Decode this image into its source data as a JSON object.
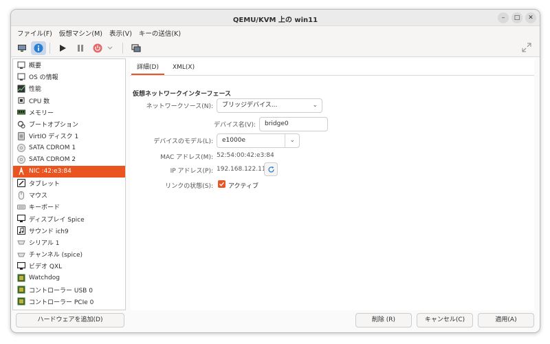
{
  "window": {
    "title": "QEMU/KVM 上の win11"
  },
  "menubar": [
    "ファイル(F)",
    "仮想マシン(M)",
    "表示(V)",
    "キーの送信(K)"
  ],
  "sidebar": {
    "items": [
      {
        "label": "概要",
        "icon": "overview-icon"
      },
      {
        "label": "OS の情報",
        "icon": "os-info-icon"
      },
      {
        "label": "性能",
        "icon": "performance-icon"
      },
      {
        "label": "CPU 数",
        "icon": "cpu-icon"
      },
      {
        "label": "メモリー",
        "icon": "memory-icon"
      },
      {
        "label": "ブートオプション",
        "icon": "boot-options-icon"
      },
      {
        "label": "VirtIO ディスク 1",
        "icon": "disk-icon"
      },
      {
        "label": "SATA CDROM 1",
        "icon": "cdrom-icon"
      },
      {
        "label": "SATA CDROM 2",
        "icon": "cdrom-icon"
      },
      {
        "label": "NIC :42:e3:84",
        "icon": "nic-icon",
        "selected": true
      },
      {
        "label": "タブレット",
        "icon": "tablet-icon"
      },
      {
        "label": "マウス",
        "icon": "mouse-icon"
      },
      {
        "label": "キーボード",
        "icon": "keyboard-icon"
      },
      {
        "label": "ディスプレイ Spice",
        "icon": "display-icon"
      },
      {
        "label": "サウンド ich9",
        "icon": "sound-icon"
      },
      {
        "label": "シリアル 1",
        "icon": "serial-icon"
      },
      {
        "label": "チャンネル (spice)",
        "icon": "channel-icon"
      },
      {
        "label": "ビデオ QXL",
        "icon": "video-icon"
      },
      {
        "label": "Watchdog",
        "icon": "watchdog-icon"
      },
      {
        "label": "コントローラー USB 0",
        "icon": "controller-icon"
      },
      {
        "label": "コントローラー PCIe 0",
        "icon": "controller-icon"
      }
    ],
    "add_hardware_label": "ハードウェアを追加(D)"
  },
  "tabs": [
    {
      "label": "詳細(D)",
      "active": true
    },
    {
      "label": "XML(X)",
      "active": false
    }
  ],
  "details": {
    "section_title": "仮想ネットワークインターフェース",
    "network_source_label": "ネットワークソース(N):",
    "network_source_value": "ブリッジデバイス...",
    "device_name_label": "デバイス名(V):",
    "device_name_value": "bridge0",
    "device_model_label": "デバイスのモデル(L):",
    "device_model_value": "e1000e",
    "mac_label": "MAC アドレス(M):",
    "mac_value": "52:54:00:42:e3:84",
    "ip_label": "IP アドレス(P):",
    "ip_value": "192.168.122.112",
    "link_state_label": "リンクの状態(S):",
    "link_state_value": "アクティブ",
    "link_state_checked": true
  },
  "footer": {
    "remove_label": "削除 (R)",
    "cancel_label": "キャンセル(C)",
    "apply_label": "適用(A)"
  },
  "colors": {
    "accent": "#e95420",
    "selection_toolbar": "#c9d7ea"
  }
}
